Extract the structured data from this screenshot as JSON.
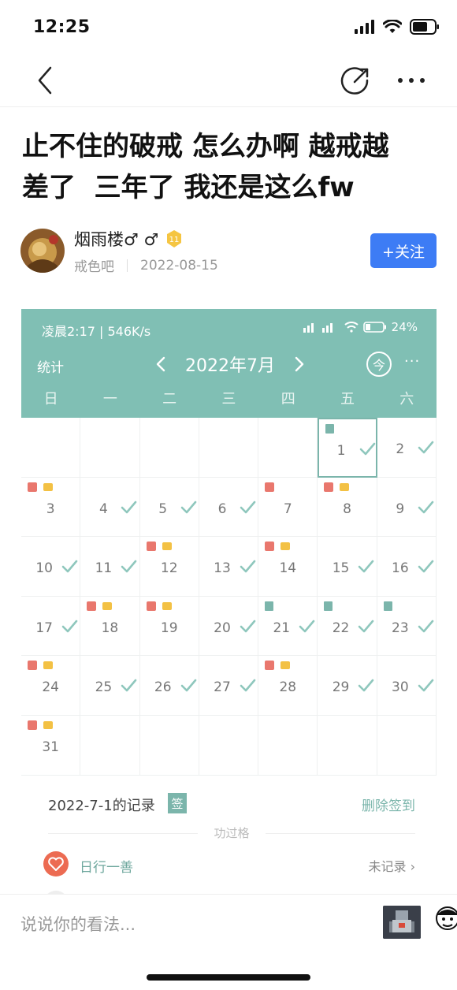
{
  "status_bar": {
    "time": "12:25"
  },
  "post": {
    "title_line1": "止不住的破戒 怎么办啊 越戒越",
    "title_line2": "差了  三年了 我还是这么fw"
  },
  "author": {
    "name": "烟雨楼♂ ♂",
    "level": "11",
    "forum": "戒色吧",
    "date": "2022-08-15",
    "follow_label": "+关注"
  },
  "embedded_app": {
    "status_left": "凌晨2:17 | 546K/s",
    "status_right": "24%",
    "stats_label": "统计",
    "month": "2022年7月",
    "today_label": "今",
    "more_label": "···",
    "weekdays": [
      "日",
      "一",
      "二",
      "三",
      "四",
      "五",
      "六"
    ],
    "days": [
      {
        "d": "1",
        "col": 5,
        "row": 0,
        "done": true,
        "marks": [
          "teal"
        ],
        "selected": true
      },
      {
        "d": "2",
        "col": 6,
        "row": 0,
        "done": true,
        "marks": []
      },
      {
        "d": "3",
        "col": 0,
        "row": 1,
        "done": false,
        "marks": [
          "red",
          "yellow"
        ]
      },
      {
        "d": "4",
        "col": 1,
        "row": 1,
        "done": true,
        "marks": []
      },
      {
        "d": "5",
        "col": 2,
        "row": 1,
        "done": true,
        "marks": []
      },
      {
        "d": "6",
        "col": 3,
        "row": 1,
        "done": true,
        "marks": []
      },
      {
        "d": "7",
        "col": 4,
        "row": 1,
        "done": false,
        "marks": [
          "red"
        ]
      },
      {
        "d": "8",
        "col": 5,
        "row": 1,
        "done": false,
        "marks": [
          "red",
          "yellow"
        ]
      },
      {
        "d": "9",
        "col": 6,
        "row": 1,
        "done": true,
        "marks": []
      },
      {
        "d": "10",
        "col": 0,
        "row": 2,
        "done": true,
        "marks": []
      },
      {
        "d": "11",
        "col": 1,
        "row": 2,
        "done": true,
        "marks": []
      },
      {
        "d": "12",
        "col": 2,
        "row": 2,
        "done": false,
        "marks": [
          "red",
          "yellow"
        ]
      },
      {
        "d": "13",
        "col": 3,
        "row": 2,
        "done": true,
        "marks": []
      },
      {
        "d": "14",
        "col": 4,
        "row": 2,
        "done": false,
        "marks": [
          "red",
          "yellow"
        ]
      },
      {
        "d": "15",
        "col": 5,
        "row": 2,
        "done": true,
        "marks": []
      },
      {
        "d": "16",
        "col": 6,
        "row": 2,
        "done": true,
        "marks": []
      },
      {
        "d": "17",
        "col": 0,
        "row": 3,
        "done": true,
        "marks": []
      },
      {
        "d": "18",
        "col": 1,
        "row": 3,
        "done": false,
        "marks": [
          "red",
          "yellow"
        ]
      },
      {
        "d": "19",
        "col": 2,
        "row": 3,
        "done": false,
        "marks": [
          "red",
          "yellow"
        ]
      },
      {
        "d": "20",
        "col": 3,
        "row": 3,
        "done": true,
        "marks": []
      },
      {
        "d": "21",
        "col": 4,
        "row": 3,
        "done": true,
        "marks": [
          "teal"
        ]
      },
      {
        "d": "22",
        "col": 5,
        "row": 3,
        "done": true,
        "marks": [
          "teal"
        ]
      },
      {
        "d": "23",
        "col": 6,
        "row": 3,
        "done": true,
        "marks": [
          "teal"
        ]
      },
      {
        "d": "24",
        "col": 0,
        "row": 4,
        "done": false,
        "marks": [
          "red",
          "yellow"
        ]
      },
      {
        "d": "25",
        "col": 1,
        "row": 4,
        "done": true,
        "marks": []
      },
      {
        "d": "26",
        "col": 2,
        "row": 4,
        "done": true,
        "marks": []
      },
      {
        "d": "27",
        "col": 3,
        "row": 4,
        "done": true,
        "marks": []
      },
      {
        "d": "28",
        "col": 4,
        "row": 4,
        "done": false,
        "marks": [
          "red",
          "yellow"
        ]
      },
      {
        "d": "29",
        "col": 5,
        "row": 4,
        "done": true,
        "marks": []
      },
      {
        "d": "30",
        "col": 6,
        "row": 4,
        "done": true,
        "marks": []
      },
      {
        "d": "31",
        "col": 0,
        "row": 5,
        "done": false,
        "marks": [
          "red",
          "yellow"
        ]
      }
    ],
    "record_title": "2022-7-1的记录",
    "sign_badge": "签",
    "delete_label": "删除签到",
    "section_label": "功过格",
    "habit_name": "日行一善",
    "habit_status": "未记录 ›"
  },
  "comment_bar": {
    "placeholder": "说说你的看法..."
  },
  "colors": {
    "accent_blue": "#3d7cf5",
    "app_teal": "#80bfb4",
    "check_teal": "#8fc7bd",
    "mark_red": "#e9776d",
    "mark_yellow": "#f3c144"
  }
}
